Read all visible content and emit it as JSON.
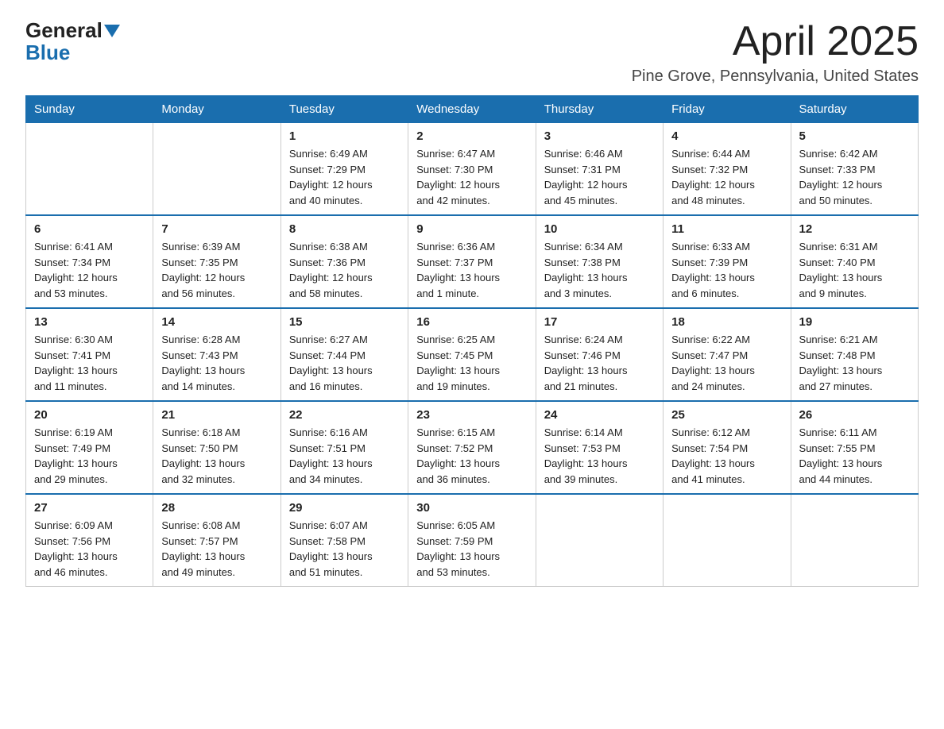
{
  "logo": {
    "general": "General",
    "blue": "Blue"
  },
  "header": {
    "month": "April 2025",
    "location": "Pine Grove, Pennsylvania, United States"
  },
  "days_of_week": [
    "Sunday",
    "Monday",
    "Tuesday",
    "Wednesday",
    "Thursday",
    "Friday",
    "Saturday"
  ],
  "weeks": [
    [
      {
        "day": "",
        "info": ""
      },
      {
        "day": "",
        "info": ""
      },
      {
        "day": "1",
        "info": "Sunrise: 6:49 AM\nSunset: 7:29 PM\nDaylight: 12 hours\nand 40 minutes."
      },
      {
        "day": "2",
        "info": "Sunrise: 6:47 AM\nSunset: 7:30 PM\nDaylight: 12 hours\nand 42 minutes."
      },
      {
        "day": "3",
        "info": "Sunrise: 6:46 AM\nSunset: 7:31 PM\nDaylight: 12 hours\nand 45 minutes."
      },
      {
        "day": "4",
        "info": "Sunrise: 6:44 AM\nSunset: 7:32 PM\nDaylight: 12 hours\nand 48 minutes."
      },
      {
        "day": "5",
        "info": "Sunrise: 6:42 AM\nSunset: 7:33 PM\nDaylight: 12 hours\nand 50 minutes."
      }
    ],
    [
      {
        "day": "6",
        "info": "Sunrise: 6:41 AM\nSunset: 7:34 PM\nDaylight: 12 hours\nand 53 minutes."
      },
      {
        "day": "7",
        "info": "Sunrise: 6:39 AM\nSunset: 7:35 PM\nDaylight: 12 hours\nand 56 minutes."
      },
      {
        "day": "8",
        "info": "Sunrise: 6:38 AM\nSunset: 7:36 PM\nDaylight: 12 hours\nand 58 minutes."
      },
      {
        "day": "9",
        "info": "Sunrise: 6:36 AM\nSunset: 7:37 PM\nDaylight: 13 hours\nand 1 minute."
      },
      {
        "day": "10",
        "info": "Sunrise: 6:34 AM\nSunset: 7:38 PM\nDaylight: 13 hours\nand 3 minutes."
      },
      {
        "day": "11",
        "info": "Sunrise: 6:33 AM\nSunset: 7:39 PM\nDaylight: 13 hours\nand 6 minutes."
      },
      {
        "day": "12",
        "info": "Sunrise: 6:31 AM\nSunset: 7:40 PM\nDaylight: 13 hours\nand 9 minutes."
      }
    ],
    [
      {
        "day": "13",
        "info": "Sunrise: 6:30 AM\nSunset: 7:41 PM\nDaylight: 13 hours\nand 11 minutes."
      },
      {
        "day": "14",
        "info": "Sunrise: 6:28 AM\nSunset: 7:43 PM\nDaylight: 13 hours\nand 14 minutes."
      },
      {
        "day": "15",
        "info": "Sunrise: 6:27 AM\nSunset: 7:44 PM\nDaylight: 13 hours\nand 16 minutes."
      },
      {
        "day": "16",
        "info": "Sunrise: 6:25 AM\nSunset: 7:45 PM\nDaylight: 13 hours\nand 19 minutes."
      },
      {
        "day": "17",
        "info": "Sunrise: 6:24 AM\nSunset: 7:46 PM\nDaylight: 13 hours\nand 21 minutes."
      },
      {
        "day": "18",
        "info": "Sunrise: 6:22 AM\nSunset: 7:47 PM\nDaylight: 13 hours\nand 24 minutes."
      },
      {
        "day": "19",
        "info": "Sunrise: 6:21 AM\nSunset: 7:48 PM\nDaylight: 13 hours\nand 27 minutes."
      }
    ],
    [
      {
        "day": "20",
        "info": "Sunrise: 6:19 AM\nSunset: 7:49 PM\nDaylight: 13 hours\nand 29 minutes."
      },
      {
        "day": "21",
        "info": "Sunrise: 6:18 AM\nSunset: 7:50 PM\nDaylight: 13 hours\nand 32 minutes."
      },
      {
        "day": "22",
        "info": "Sunrise: 6:16 AM\nSunset: 7:51 PM\nDaylight: 13 hours\nand 34 minutes."
      },
      {
        "day": "23",
        "info": "Sunrise: 6:15 AM\nSunset: 7:52 PM\nDaylight: 13 hours\nand 36 minutes."
      },
      {
        "day": "24",
        "info": "Sunrise: 6:14 AM\nSunset: 7:53 PM\nDaylight: 13 hours\nand 39 minutes."
      },
      {
        "day": "25",
        "info": "Sunrise: 6:12 AM\nSunset: 7:54 PM\nDaylight: 13 hours\nand 41 minutes."
      },
      {
        "day": "26",
        "info": "Sunrise: 6:11 AM\nSunset: 7:55 PM\nDaylight: 13 hours\nand 44 minutes."
      }
    ],
    [
      {
        "day": "27",
        "info": "Sunrise: 6:09 AM\nSunset: 7:56 PM\nDaylight: 13 hours\nand 46 minutes."
      },
      {
        "day": "28",
        "info": "Sunrise: 6:08 AM\nSunset: 7:57 PM\nDaylight: 13 hours\nand 49 minutes."
      },
      {
        "day": "29",
        "info": "Sunrise: 6:07 AM\nSunset: 7:58 PM\nDaylight: 13 hours\nand 51 minutes."
      },
      {
        "day": "30",
        "info": "Sunrise: 6:05 AM\nSunset: 7:59 PM\nDaylight: 13 hours\nand 53 minutes."
      },
      {
        "day": "",
        "info": ""
      },
      {
        "day": "",
        "info": ""
      },
      {
        "day": "",
        "info": ""
      }
    ]
  ]
}
